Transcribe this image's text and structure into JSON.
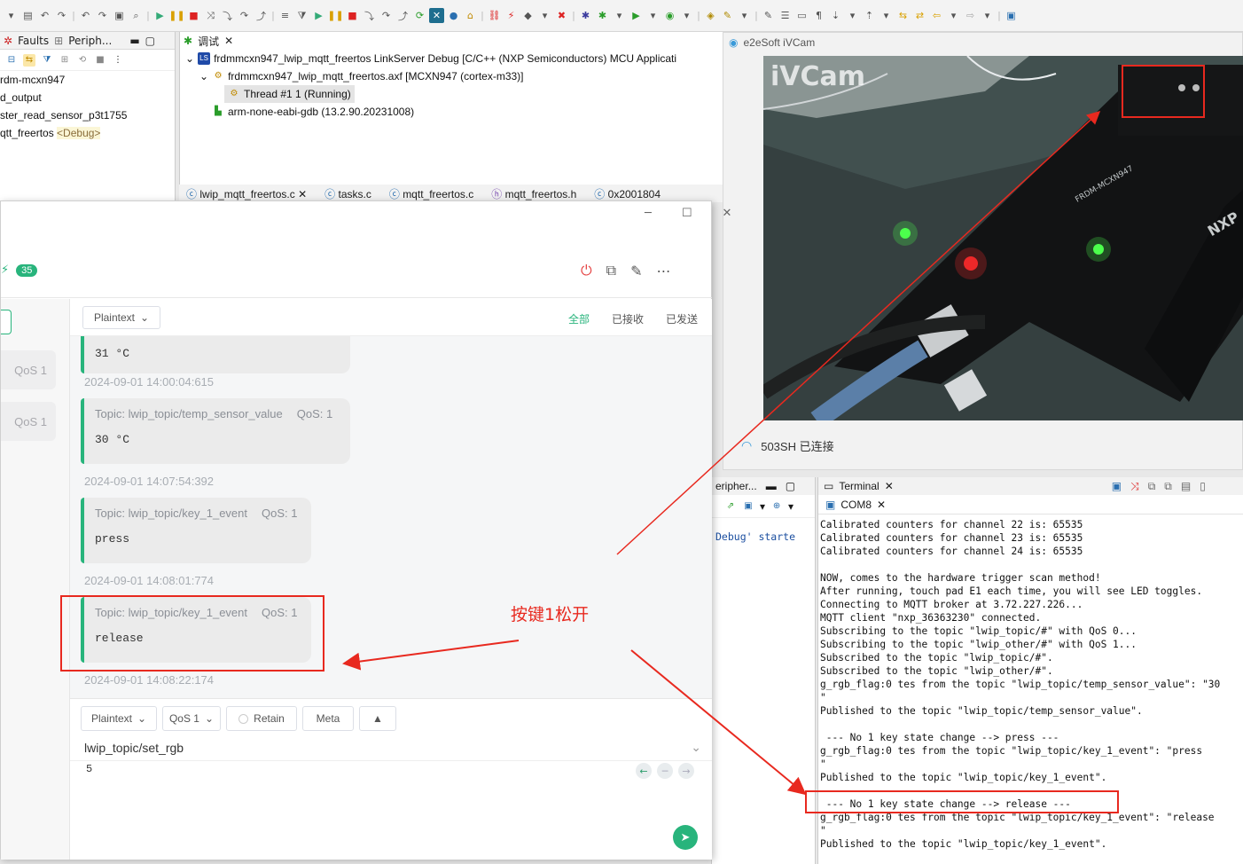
{
  "left_view": {
    "tabs": [
      "Faults",
      "Periph..."
    ],
    "items": [
      {
        "label": "rdm-mcxn947"
      },
      {
        "label": "d_output"
      },
      {
        "label": "ster_read_sensor_p3t1755"
      },
      {
        "label": "qtt_freertos",
        "tag": "<Debug>"
      }
    ]
  },
  "debug_view": {
    "tab": "调试",
    "rows": [
      {
        "label": "frdmmcxn947_lwip_mqtt_freertos LinkServer Debug [C/C++ (NXP Semiconductors) MCU Applicati"
      },
      {
        "label": "frdmmcxn947_lwip_mqtt_freertos.axf [MCXN947 (cortex-m33)]"
      },
      {
        "label": "Thread #1 1 (Running)"
      },
      {
        "label": "arm-none-eabi-gdb (13.2.90.20231008)"
      }
    ]
  },
  "editor_tabs": [
    "lwip_mqtt_freertos.c",
    "tasks.c",
    "mqtt_freertos.c",
    "mqtt_freertos.h",
    "0x2001804"
  ],
  "mqttx": {
    "badge": "35",
    "format": "Plaintext",
    "filters": {
      "all": "全部",
      "received": "已接收",
      "sent": "已发送"
    },
    "left_qos": [
      "QoS 1",
      "QoS 1"
    ],
    "messages": [
      {
        "topic": "",
        "qos": "",
        "payload": "31 °C",
        "time": "2024-09-01 14:00:04:615"
      },
      {
        "topic": "Topic: lwip_topic/temp_sensor_value",
        "qos": "QoS: 1",
        "payload": "30 °C",
        "time": "2024-09-01 14:07:54:392"
      },
      {
        "topic": "Topic: lwip_topic/key_1_event",
        "qos": "QoS: 1",
        "payload": "press",
        "time": "2024-09-01 14:08:01:774"
      },
      {
        "topic": "Topic: lwip_topic/key_1_event",
        "qos": "QoS: 1",
        "payload": "release",
        "time": "2024-09-01 14:08:22:174"
      }
    ],
    "composer": {
      "format": "Plaintext",
      "qos": "QoS 1",
      "retain": "Retain",
      "meta": "Meta",
      "topic": "lwip_topic/set_rgb",
      "payload": "5"
    }
  },
  "annotation": {
    "text": "按键1松开",
    "color": "#e8291f"
  },
  "camera": {
    "title": "e2eSoft iVCam",
    "watermark": "iVCam",
    "wifi_status": "503SH 已连接",
    "board_label": "FRDM-MCXN947",
    "brand": "NXP"
  },
  "periph_mini": {
    "tab": "eripher...",
    "text": "Debug' starte"
  },
  "terminal": {
    "tab": "Terminal",
    "port": "COM8",
    "lines": [
      "Calibrated counters for channel 22 is: 65535",
      "Calibrated counters for channel 23 is: 65535",
      "Calibrated counters for channel 24 is: 65535",
      "",
      "NOW, comes to the hardware trigger scan method!",
      "After running, touch pad E1 each time, you will see LED toggles.",
      "Connecting to MQTT broker at 3.72.227.226...",
      "MQTT client \"nxp_36363230\" connected.",
      "Subscribing to the topic \"lwip_topic/#\" with QoS 0...",
      "Subscribing to the topic \"lwip_other/#\" with QoS 1...",
      "Subscribed to the topic \"lwip_topic/#\".",
      "Subscribed to the topic \"lwip_other/#\".",
      "g_rgb_flag:0 tes from the topic \"lwip_topic/temp_sensor_value\": \"30",
      "\"",
      "Published to the topic \"lwip_topic/temp_sensor_value\".",
      "",
      " --- No 1 key state change --> press ---",
      "g_rgb_flag:0 tes from the topic \"lwip_topic/key_1_event\": \"press",
      "\"",
      "Published to the topic \"lwip_topic/key_1_event\".",
      "",
      " --- No 1 key state change --> release ---",
      "g_rgb_flag:0 tes from the topic \"lwip_topic/key_1_event\": \"release",
      "\"",
      "Published to the topic \"lwip_topic/key_1_event\"."
    ]
  },
  "colors": {
    "accent": "#28b47c",
    "highlight": "#e8291f",
    "debug_tag": "#8a6d3b"
  }
}
